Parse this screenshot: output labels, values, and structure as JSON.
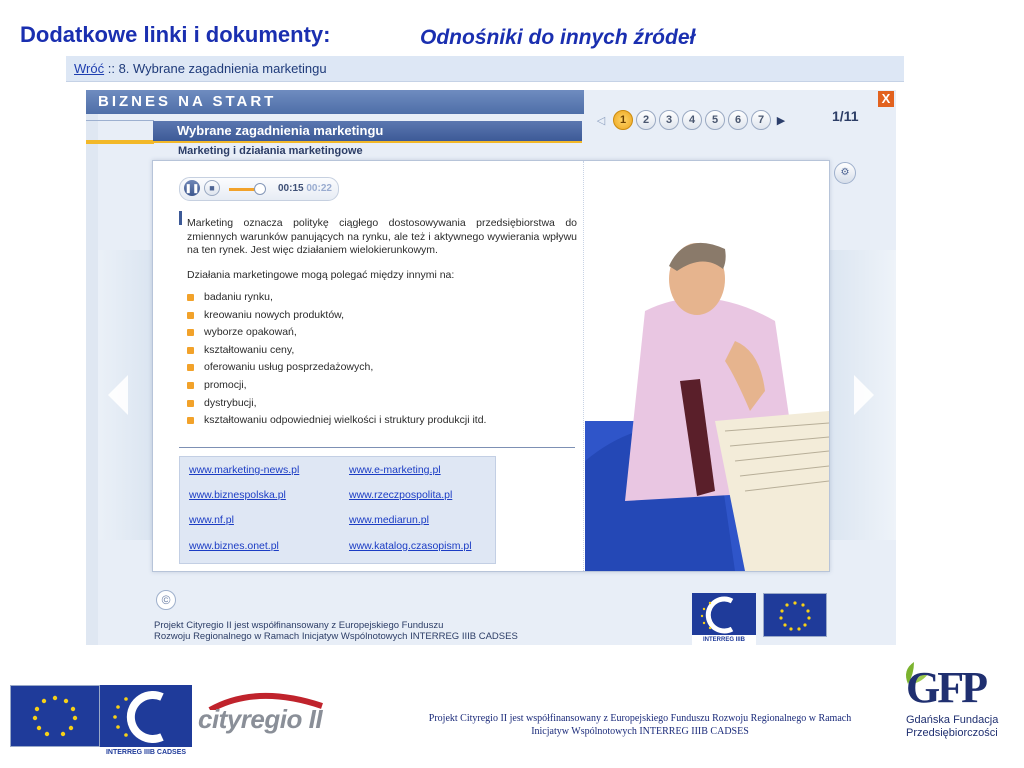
{
  "slide": {
    "title": "Dodatkowe linki i dokumenty:",
    "subtitle": "Odnośniki do innych źródeł"
  },
  "breadcrumb": {
    "back_label": "Wróć",
    "separator": " :: ",
    "current": "8. Wybrane zagadnienia marketingu"
  },
  "app": {
    "brand": "BIZNES NA START",
    "close_label": "X",
    "section_title": "Wybrane zagadnienia marketingu",
    "subsection_title": "Marketing i działania marketingowe",
    "pagination": {
      "prev_icon": "◁",
      "next_icon": "▶",
      "pages": [
        "1",
        "2",
        "3",
        "4",
        "5",
        "6",
        "7"
      ],
      "active_page": "1",
      "counter": "1/11"
    },
    "player": {
      "pause_icon": "❚❚",
      "stop_icon": "■",
      "current_time": "00:15",
      "total_time": "00:22",
      "progress": 0.68
    },
    "content": {
      "paragraph": "Marketing oznacza politykę ciągłego dostosowywania przedsiębiorstwa do zmiennych warunków panujących na rynku, ale też i aktywnego wywierania wpływu na ten rynek. Jest więc działaniem wielokierunkowym.",
      "list_intro": "Działania marketingowe mogą polegać między innymi na:",
      "bullets": [
        "badaniu rynku,",
        "kreowaniu nowych produktów,",
        "wyborze opakowań,",
        "kształtowaniu ceny,",
        "oferowaniu usług posprzedażowych,",
        "promocji,",
        "dystrybucji,",
        "kształtowaniu odpowiedniej wielkości i struktury produkcji itd."
      ]
    },
    "links": {
      "left": [
        "www.marketing-news.pl",
        "www.biznespolska.pl",
        "www.nf.pl",
        "www.biznes.onet.pl"
      ],
      "right": [
        "www.e-marketing.pl",
        "www.rzeczpospolita.pl",
        "www.mediarun.pl",
        "www.katalog.czasopism.pl"
      ]
    },
    "copyright_icon": "©",
    "project_note_line1": "Projekt Cityregio II jest współfinansowany z Europejskiego Funduszu",
    "project_note_line2": "Rozwoju Regionalnego w Ramach Inicjatyw Wspólnotowych INTERREG IIIB CADSES",
    "interreg_label": "INTERREG IIIB CADSES"
  },
  "footer": {
    "interreg_label": "INTERREG IIIB CADSES",
    "cityregio_logo": "cityregio II",
    "note_line1": "Projekt Cityregio II jest współfinansowany z Europejskiego Funduszu Rozwoju Regionalnego w Ramach",
    "note_line2": "Inicjatyw Wspólnotowych INTERREG IIIB CADSES",
    "gfp_logo": "GFP",
    "gfp_line1": "Gdańska Fundacja",
    "gfp_line2": "Przedsiębiorczości"
  },
  "colors": {
    "title_blue": "#1a2fb0",
    "accent_orange": "#f2a22a",
    "header_blue": "#4e6ea8",
    "eu_blue": "#1f3b9a",
    "eu_star": "#f7d117"
  }
}
